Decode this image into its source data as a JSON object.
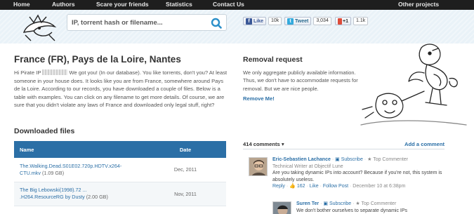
{
  "nav": {
    "items": [
      "Home",
      "Authors",
      "Scare your friends",
      "Statistics",
      "Contact Us"
    ],
    "right": "Other projects"
  },
  "search": {
    "placeholder": "IP, torrent hash or filename..."
  },
  "social": {
    "facebook": {
      "label": "Like",
      "count": "10k"
    },
    "twitter": {
      "label": "Tweet",
      "count": "3,034"
    },
    "gplus": {
      "label": "+1",
      "count": "1.1k"
    }
  },
  "main": {
    "title": "France (FR), Pays de la Loire, Nantes",
    "intro_prefix": "Hi Pirate IP",
    "intro": "We got you! (In our database). You like torrents, don't you? At least someone in your house does. It looks like you are from France, somewhere around Pays de la Loire. According to our records, you have downloaded a couple of files. Below is a table with examples. You can click on any filename to get more details. Of course, we are sure that you didn't violate any laws of France and downloaded only legal stuff, right?",
    "downloads_heading": "Downloaded files",
    "table": {
      "headers": [
        "Name",
        "Date"
      ],
      "rows": [
        {
          "name_line1": "The.Walking.Dead.S01E02.720p.HDTV.x264-",
          "name_line2": "CTU.mkv",
          "size": "(1.09 GB)",
          "date": "Dec, 2011"
        },
        {
          "name_line1": "The Big Lebowski(1998).72 ...",
          "name_line2": ".H264.ResourceRG by Dusty",
          "size": "(2.00 GB)",
          "date": "Nov, 2011"
        }
      ]
    }
  },
  "removal": {
    "heading": "Removal request",
    "text": "We only aggregate publicly available information. Thus, we don't have to accommodate requests for removal. But we are nice people.",
    "link": "Remove Me!"
  },
  "comments": {
    "count": "414 comments",
    "count_suffix": "▾",
    "add": "Add a comment",
    "items": [
      {
        "name": "Eric-Sebastien Lachance",
        "subscribe": "Subscribe",
        "badge": "Top Commenter",
        "role": "Technical Writer at Objectif Lune",
        "text": "Are you taking dynamic IPs into account? Because if you're not, this system is absolutely useless.",
        "reply": "Reply",
        "likes": "162",
        "like": "Like",
        "follow": "Follow Post",
        "date": "December 10 at 6:38pm"
      },
      {
        "name": "Suren Ter",
        "subscribe": "Subscribe",
        "badge": "Top Commenter",
        "text": "We don't bother ourselves to separate dynamic IPs"
      }
    ]
  },
  "colors": {
    "accent": "#2b6fa6",
    "nav_bg": "#1e1e1e",
    "header_bg": "#e9f2f8"
  }
}
